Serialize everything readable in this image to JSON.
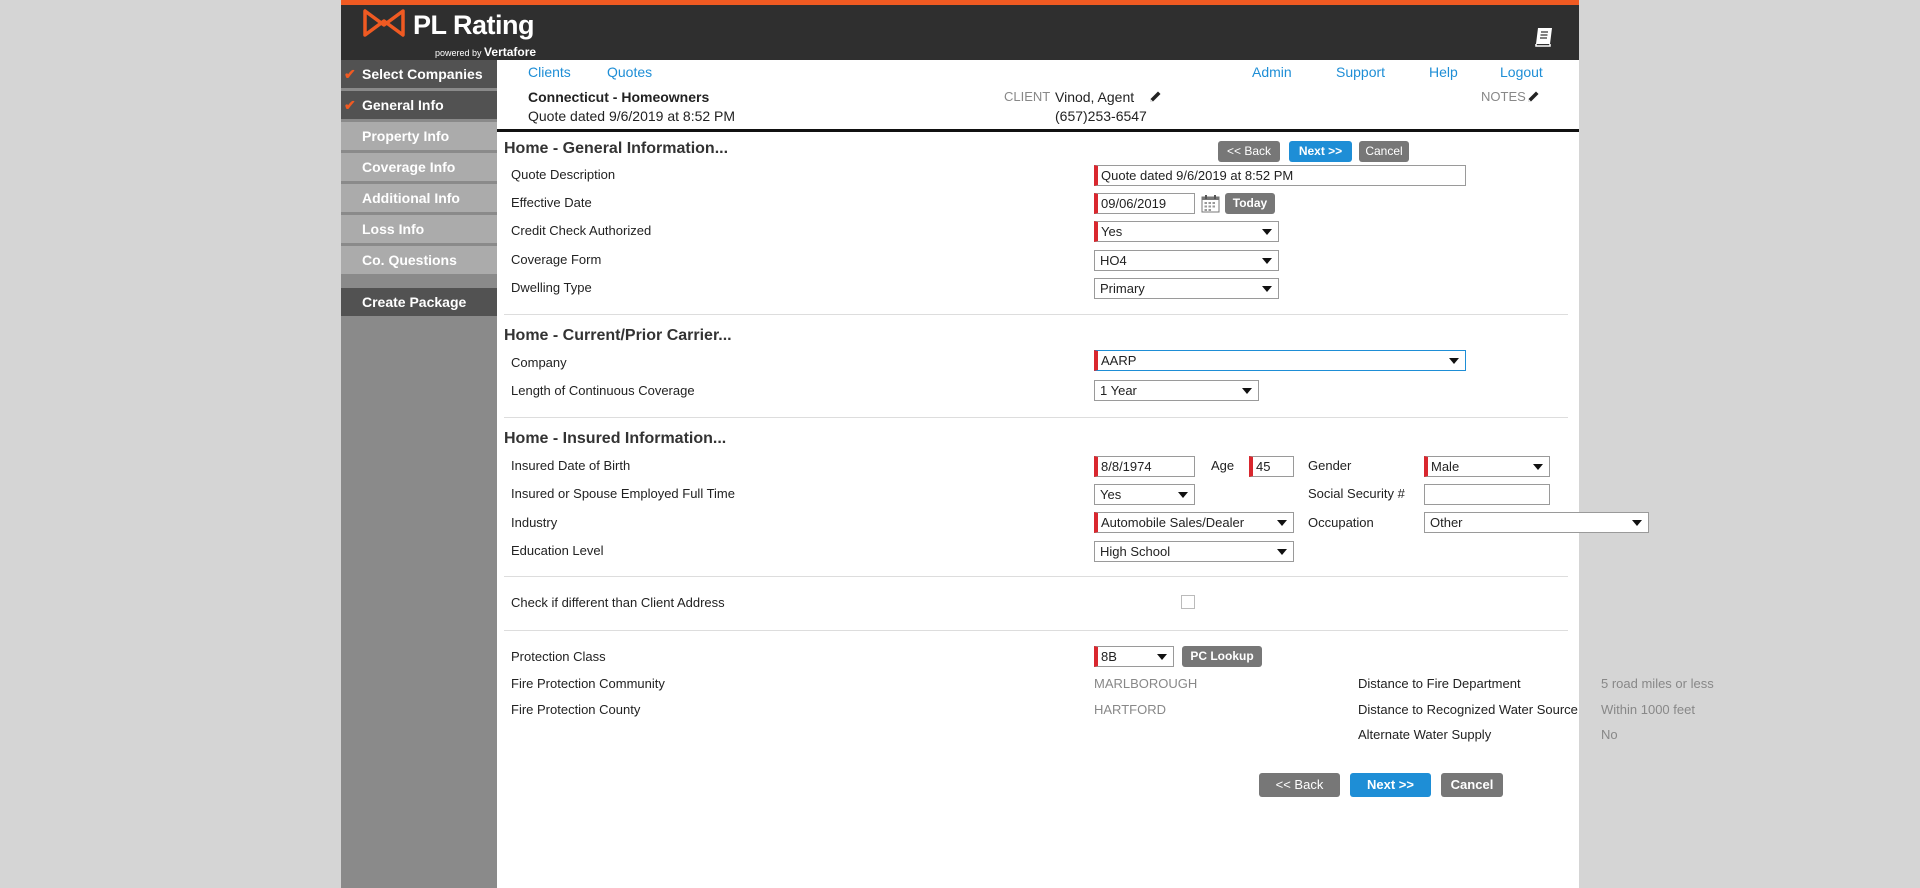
{
  "app": {
    "logo_title": "PL Rating",
    "logo_sub_prefix": "powered by",
    "logo_sub_brand": "Vertafore"
  },
  "colors": {
    "accent": "#f05a22",
    "link": "#1e8ed6",
    "required": "#d9272e",
    "topbar": "#2f2f2f"
  },
  "sidebar": {
    "items": [
      {
        "label": "Select Companies",
        "done": true
      },
      {
        "label": "General Info",
        "done": true
      },
      {
        "label": "Property Info",
        "done": false
      },
      {
        "label": "Coverage Info",
        "done": false
      },
      {
        "label": "Additional Info",
        "done": false
      },
      {
        "label": "Loss Info",
        "done": false
      },
      {
        "label": "Co. Questions",
        "done": false
      }
    ],
    "create_package": "Create Package"
  },
  "nav": {
    "clients": "Clients",
    "quotes": "Quotes",
    "admin": "Admin",
    "support": "Support",
    "help": "Help",
    "logout": "Logout"
  },
  "quote": {
    "title": "Connecticut - Homeowners",
    "dated": "Quote dated 9/6/2019 at 8:52 PM",
    "client_label": "CLIENT",
    "client_name": "Vinod, Agent",
    "client_phone": "(657)253-6547",
    "notes_label": "NOTES"
  },
  "buttons": {
    "back": "<< Back",
    "next": "Next >>",
    "cancel": "Cancel",
    "today": "Today",
    "pc_lookup": "PC Lookup"
  },
  "general": {
    "title": "Home - General Information...",
    "quote_description_label": "Quote Description",
    "quote_description": "Quote dated 9/6/2019 at 8:52 PM",
    "effective_date_label": "Effective Date",
    "effective_date": "09/06/2019",
    "credit_check_label": "Credit Check Authorized",
    "credit_check": "Yes",
    "coverage_form_label": "Coverage Form",
    "coverage_form": "HO4",
    "dwelling_type_label": "Dwelling Type",
    "dwelling_type": "Primary"
  },
  "carrier": {
    "title": "Home - Current/Prior Carrier...",
    "company_label": "Company",
    "company": "AARP",
    "length_label": "Length of Continuous Coverage",
    "length": "1 Year"
  },
  "insured": {
    "title": "Home - Insured Information...",
    "dob_label": "Insured Date of Birth",
    "dob": "8/8/1974",
    "age_label": "Age",
    "age": "45",
    "gender_label": "Gender",
    "gender": "Male",
    "employed_label": "Insured or Spouse Employed Full Time",
    "employed": "Yes",
    "ssn_label": "Social Security #",
    "ssn": "",
    "industry_label": "Industry",
    "industry": "Automobile Sales/Dealer",
    "occupation_label": "Occupation",
    "occupation": "Other",
    "education_label": "Education Level",
    "education": "High School"
  },
  "address": {
    "different_label": "Check if different than Client Address",
    "checked": false
  },
  "protection": {
    "class_label": "Protection Class",
    "class": "8B",
    "community_label": "Fire Protection Community",
    "community": "MARLBOROUGH",
    "county_label": "Fire Protection County",
    "county": "HARTFORD",
    "distance_fd_label": "Distance to Fire Department",
    "distance_fd": "5 road miles or less",
    "distance_water_label": "Distance to Recognized Water Source",
    "distance_water": "Within 1000 feet",
    "alt_water_label": "Alternate Water Supply",
    "alt_water": "No"
  }
}
